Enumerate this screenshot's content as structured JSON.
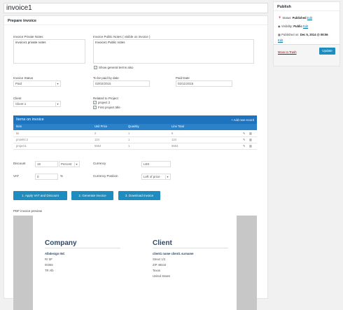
{
  "title": "invoice1",
  "prepare_invoice": {
    "heading": "Prepare invoice",
    "private_notes_label": "Invoice Private Notes",
    "private_notes_value": "invoice1 private notes",
    "public_notes_label": "Invoice Public Notes ( visible on invoice )",
    "public_notes_value": "Invoice1 Public notes",
    "show_general_terms_label": "Show general terms also",
    "status_label": "Invoice Status",
    "status_value": "Paid",
    "to_be_paid_label": "To be paid by date",
    "to_be_paid_value": "02/02/2015",
    "paid_date_label": "Paid Date",
    "paid_date_value": "02/11/2015",
    "client_label": "Client",
    "client_value": "Client 1",
    "related_label": "Related to Project",
    "related_projects": [
      "project 2",
      "First project title"
    ]
  },
  "items": {
    "heading": "Items on invoice",
    "add_label": "+ Add new record",
    "columns": [
      "Item",
      "Unit Price",
      "Quantity",
      "Line Total"
    ],
    "rows": [
      [
        "kk",
        "2",
        "1",
        "6"
      ],
      [
        "proiekti 2",
        "124",
        "1",
        "124"
      ],
      [
        "project1",
        "5554",
        "1",
        "5554"
      ]
    ]
  },
  "totals": {
    "discount_label": "Discount",
    "discount_value": "15",
    "discount_type": "Percent",
    "vat_label": "VAT",
    "vat_value": "0",
    "vat_unit": "%",
    "currency_label": "Currency",
    "currency_value": "LEK",
    "currency_position_label": "Currency Position",
    "currency_position_value": "Left of price"
  },
  "buttons": {
    "apply": "1. Apply VAT and Discount",
    "generate": "2. Generate Invoice",
    "download": "3. Download invoice"
  },
  "pdf": {
    "label": "PDF invoice preview",
    "company_title": "Company",
    "company_lines": [
      "Albdesign INC",
      "Rr 5P",
      "00355",
      "TR Alb"
    ],
    "client_title": "Client",
    "client_lines": [
      "client1 name client1 surname",
      "Street 1/2",
      "ZIP 46544",
      "Texas",
      "United States"
    ]
  },
  "publish": {
    "heading": "Publish",
    "status_label": "Status:",
    "status_value": "Published",
    "visibility_label": "Visibility:",
    "visibility_value": "Public",
    "published_label": "Published on:",
    "published_value": "Dec 5, 2014 @ 08:56",
    "edit": "Edit",
    "trash": "Move to Trash",
    "update": "Update"
  },
  "colors": {
    "accent": "#1e8cbe",
    "header_blue": "#1e73be",
    "company_blue": "#2d4a6d"
  }
}
